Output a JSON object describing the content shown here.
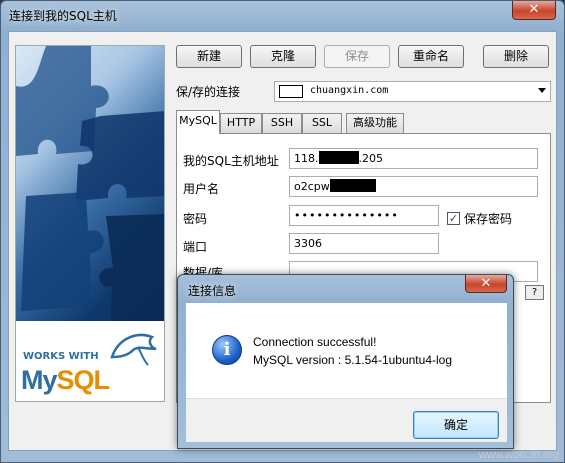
{
  "window": {
    "title": "连接到我的SQL主机"
  },
  "toolbar": {
    "new_label": "新建",
    "clone_label": "克隆",
    "save_label": "保存",
    "rename_label": "重命名",
    "delete_label": "删除"
  },
  "connection": {
    "label": "保/存的连接",
    "value": "chuangxin.com"
  },
  "tabs": [
    {
      "label": "MySQL",
      "active": true
    },
    {
      "label": "HTTP"
    },
    {
      "label": "SSH"
    },
    {
      "label": "SSL"
    },
    {
      "label": "高级功能"
    }
  ],
  "form": {
    "host_label": "我的SQL主机地址",
    "host_prefix": "118.",
    "host_suffix": ".205",
    "user_label": "用户名",
    "user_prefix": "o2cpw",
    "password_label": "密码",
    "password_value": "••••••••••••••",
    "save_password_label": "保存密码",
    "save_password_checked": true,
    "port_label": "端口",
    "port_value": "3306",
    "database_label": "数据/库",
    "help_label": "?"
  },
  "logo": {
    "works_with": "WORKS WITH",
    "brand_my": "My",
    "brand_sql": "SQL"
  },
  "dialog": {
    "title": "连接信息",
    "close": "✕",
    "line1": "Connection successful!",
    "line2": "MySQL version : 5.1.54-1ubuntu4-log",
    "ok_label": "确定"
  },
  "watermark": "www.woo..in.org"
}
